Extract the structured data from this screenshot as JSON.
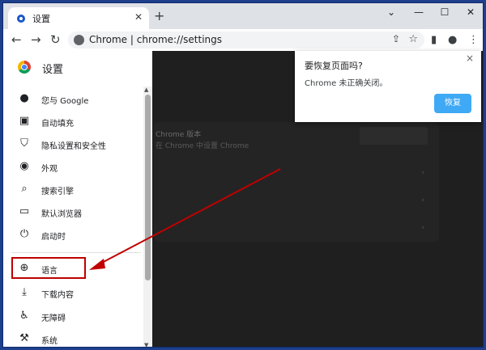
{
  "tab": {
    "title": "设置",
    "close": "✕",
    "new_tab": "+"
  },
  "window_controls": {
    "dropdown": "⌄",
    "minimize": "—",
    "maximize": "☐",
    "close": "✕"
  },
  "toolbar": {
    "back": "←",
    "forward": "→",
    "reload": "↻",
    "omnibox_text": "Chrome  |  chrome://settings",
    "share_icon": "⇪",
    "star_icon": "☆",
    "sidepanel_icon": "▮",
    "profile_icon": "●",
    "menu_icon": "⋮"
  },
  "sidebar": {
    "title": "设置",
    "items": [
      {
        "label": "您与 Google",
        "icon": "person-icon",
        "glyph": "●"
      },
      {
        "label": "自动填充",
        "icon": "clipboard-icon",
        "glyph": "▣"
      },
      {
        "label": "隐私设置和安全性",
        "icon": "shield-icon",
        "glyph": "⛉"
      },
      {
        "label": "外观",
        "icon": "palette-icon",
        "glyph": "◉"
      },
      {
        "label": "搜索引擎",
        "icon": "search-icon",
        "glyph": "⌕"
      },
      {
        "label": "默认浏览器",
        "icon": "browser-icon",
        "glyph": "▭"
      },
      {
        "label": "启动时",
        "icon": "power-icon",
        "glyph": "⏻"
      },
      {
        "label": "语言",
        "icon": "globe-icon",
        "glyph": "⊕"
      },
      {
        "label": "下载内容",
        "icon": "download-icon",
        "glyph": "⤓"
      },
      {
        "label": "无障碍",
        "icon": "accessibility-icon",
        "glyph": "♿"
      },
      {
        "label": "系统",
        "icon": "wrench-icon",
        "glyph": "⚒"
      }
    ]
  },
  "content": {
    "card_title": "Chrome 版本",
    "card_sub": "在 Chrome 中设置 Chrome",
    "chevron": "›"
  },
  "popup": {
    "title": "要恢复页面吗?",
    "message": "Chrome 未正确关闭。",
    "restore_label": "恢复",
    "close": "×"
  },
  "colors": {
    "highlight": "#c00000",
    "restore_button": "#3fa9f5",
    "content_bg": "#1f1f1f"
  }
}
